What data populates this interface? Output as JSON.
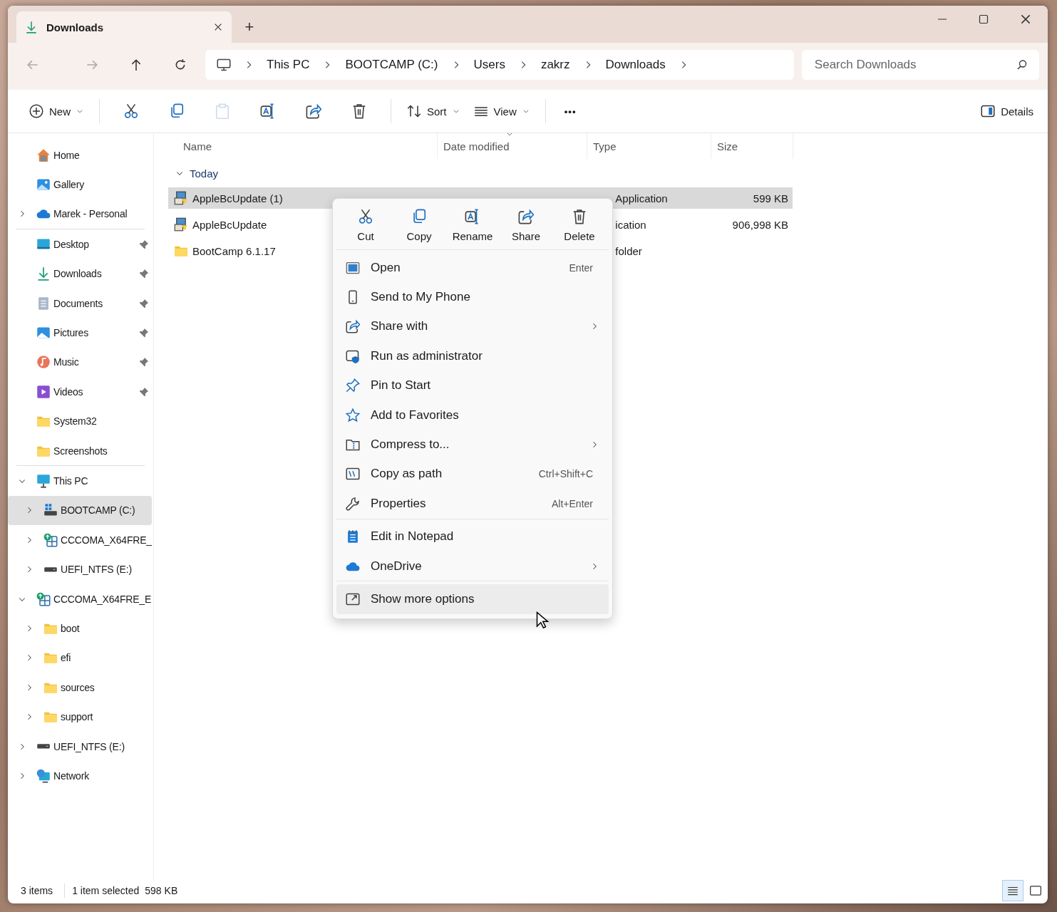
{
  "window": {
    "tab": {
      "title": "Downloads",
      "selected": true
    },
    "new_tab": "+"
  },
  "navigation": {
    "breadcrumbs": [
      "This PC",
      "BOOTCAMP (C:)",
      "Users",
      "zakrz",
      "Downloads"
    ],
    "search": {
      "placeholder": "Search Downloads"
    }
  },
  "command_bar": {
    "new": "New",
    "sort": "Sort",
    "view": "View",
    "more": "•••",
    "details": "Details",
    "tools": [
      {
        "kind": "cut",
        "disabled": false
      },
      {
        "kind": "copy",
        "disabled": false
      },
      {
        "kind": "paste",
        "disabled": true
      },
      {
        "kind": "rename",
        "disabled": false
      },
      {
        "kind": "share",
        "disabled": false
      },
      {
        "kind": "delete",
        "disabled": false
      }
    ]
  },
  "sidebar": {
    "groups": [
      [
        {
          "label": "Home",
          "kind": "home"
        },
        {
          "label": "Gallery",
          "kind": "gallery"
        },
        {
          "label": "Marek - Personal",
          "kind": "cloud",
          "expanded": false
        }
      ],
      [
        {
          "label": "Desktop",
          "kind": "desktop",
          "pinned": true
        },
        {
          "label": "Downloads",
          "kind": "downloads",
          "pinned": true
        },
        {
          "label": "Documents",
          "kind": "documents",
          "pinned": true
        },
        {
          "label": "Pictures",
          "kind": "pictures",
          "pinned": true
        },
        {
          "label": "Music",
          "kind": "music",
          "pinned": true
        },
        {
          "label": "Videos",
          "kind": "videos",
          "pinned": true
        },
        {
          "label": "System32",
          "kind": "folder",
          "pinned": false
        },
        {
          "label": "Screenshots",
          "kind": "folder",
          "pinned": false
        }
      ],
      [
        {
          "label": "This PC",
          "kind": "pc",
          "expanded": true,
          "children": [
            {
              "label": "BOOTCAMP (C:)",
              "kind": "winDrive",
              "expanded": false,
              "selected": true
            },
            {
              "label": "CCCOMA_X64FRE_",
              "kind": "disc",
              "expanded": false,
              "selected": false
            },
            {
              "label": "UEFI_NTFS (E:)",
              "kind": "drive",
              "expanded": false,
              "selected": false
            }
          ]
        },
        {
          "label": "CCCOMA_X64FRE_E",
          "kind": "disc",
          "expanded": true,
          "children": [
            {
              "label": "boot",
              "kind": "folder",
              "expanded": false,
              "selected": false
            },
            {
              "label": "efi",
              "kind": "folder",
              "expanded": false,
              "selected": false
            },
            {
              "label": "sources",
              "kind": "folder",
              "expanded": false,
              "selected": false
            },
            {
              "label": "support",
              "kind": "folder",
              "expanded": false,
              "selected": false
            }
          ]
        },
        {
          "label": "UEFI_NTFS (E:)",
          "kind": "drive",
          "expanded": false
        },
        {
          "label": "Network",
          "kind": "network",
          "expanded": false
        }
      ]
    ]
  },
  "file_list": {
    "columns": [
      "Name",
      "Date modified",
      "Type",
      "Size"
    ],
    "group": {
      "label": "Today",
      "expanded": true
    },
    "rows": [
      {
        "name": "AppleBcUpdate (1)",
        "kind": "installer",
        "type": "Application",
        "size": "599 KB",
        "selected": true
      },
      {
        "name": "AppleBcUpdate",
        "kind": "installer",
        "type": "ication",
        "size": "906,998 KB",
        "selected": false
      },
      {
        "name": "BootCamp 6.1.17",
        "kind": "folder",
        "type": "folder",
        "size": "",
        "selected": false
      }
    ]
  },
  "context_menu": {
    "actions": [
      {
        "label": "Cut",
        "kind": "cut"
      },
      {
        "label": "Copy",
        "kind": "copy"
      },
      {
        "label": "Rename",
        "kind": "rename"
      },
      {
        "label": "Share",
        "kind": "share"
      },
      {
        "label": "Delete",
        "kind": "delete"
      }
    ],
    "sections": [
      [
        {
          "label": "Open",
          "kind": "open",
          "shortcut": "Enter",
          "submenu": false,
          "highlighted": false
        },
        {
          "label": "Send to My Phone",
          "kind": "phone",
          "submenu": false,
          "highlighted": false
        },
        {
          "label": "Share with",
          "kind": "share",
          "submenu": true,
          "highlighted": false
        },
        {
          "label": "Run as administrator",
          "kind": "admin",
          "submenu": false,
          "highlighted": false
        },
        {
          "label": "Pin to Start",
          "kind": "pin",
          "submenu": false,
          "highlighted": false
        },
        {
          "label": "Add to Favorites",
          "kind": "star",
          "submenu": false,
          "highlighted": false
        },
        {
          "label": "Compress to...",
          "kind": "zip",
          "submenu": true,
          "highlighted": false
        },
        {
          "label": "Copy as path",
          "kind": "path",
          "shortcut": "Ctrl+Shift+C",
          "submenu": false,
          "highlighted": false
        },
        {
          "label": "Properties",
          "kind": "wrench",
          "shortcut": "Alt+Enter",
          "submenu": false,
          "highlighted": false
        }
      ],
      [
        {
          "label": "Edit in Notepad",
          "kind": "notepad",
          "submenu": false,
          "highlighted": false
        },
        {
          "label": "OneDrive",
          "kind": "cloud",
          "submenu": true,
          "highlighted": false
        }
      ],
      [
        {
          "label": "Show more options",
          "kind": "more",
          "submenu": false,
          "highlighted": true
        }
      ]
    ]
  },
  "status_bar": {
    "count": "3 items",
    "selection": "1 item selected",
    "selection_size": "598 KB",
    "views": [
      {
        "kind": "details",
        "selected": true
      },
      {
        "kind": "tiles",
        "selected": false
      }
    ]
  }
}
